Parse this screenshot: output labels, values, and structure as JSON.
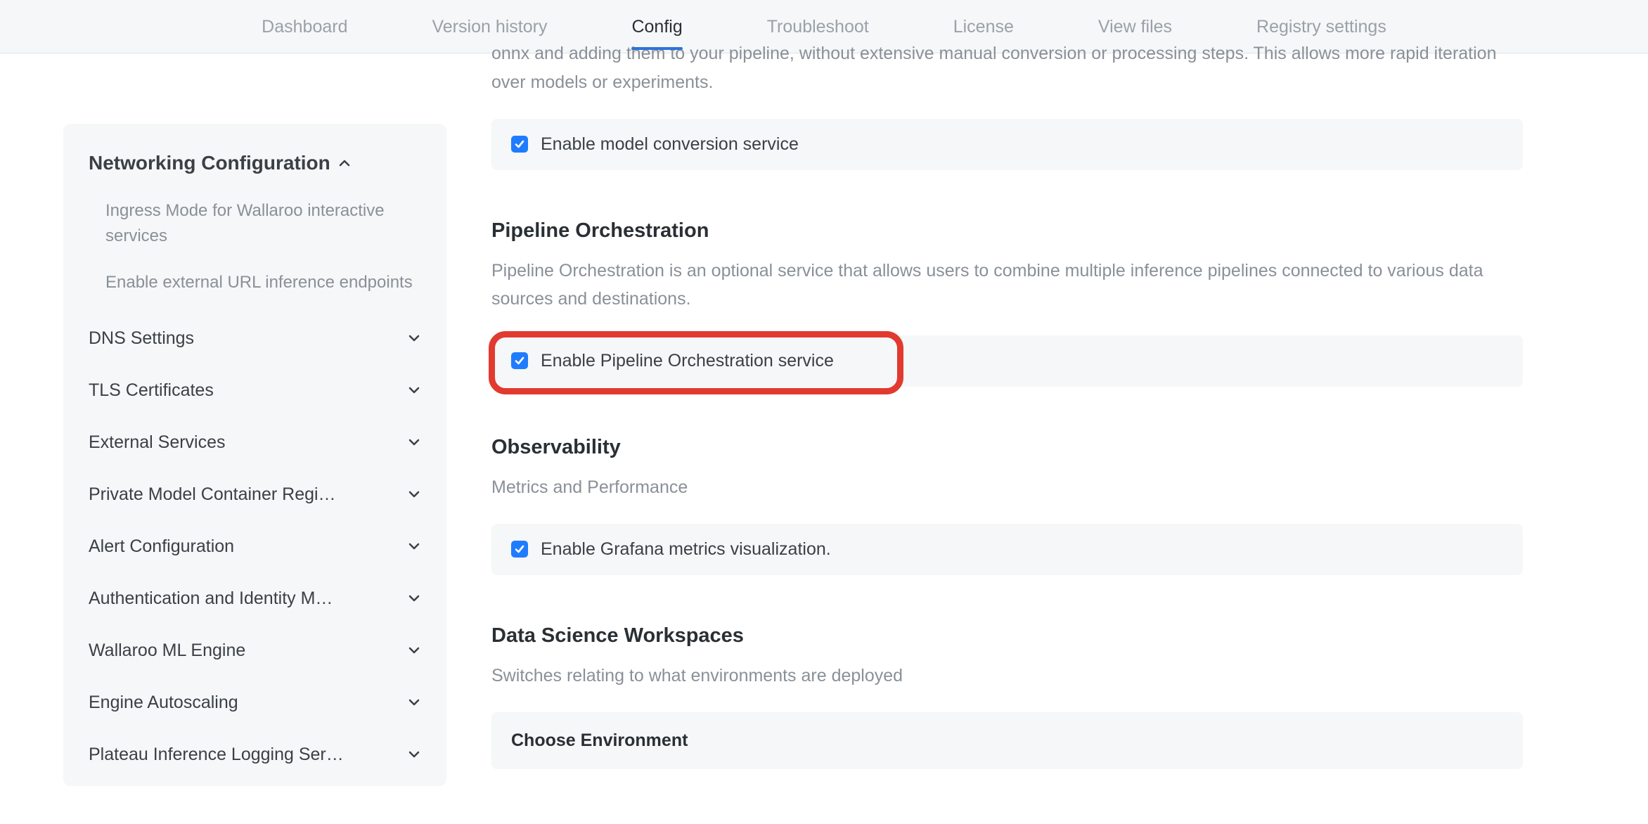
{
  "nav": {
    "items": [
      {
        "label": "Dashboard",
        "active": false
      },
      {
        "label": "Version history",
        "active": false
      },
      {
        "label": "Config",
        "active": true
      },
      {
        "label": "Troubleshoot",
        "active": false
      },
      {
        "label": "License",
        "active": false
      },
      {
        "label": "View files",
        "active": false
      },
      {
        "label": "Registry settings",
        "active": false
      }
    ]
  },
  "sidebar": {
    "expanded_section": "Networking Configuration",
    "subitems": [
      "Ingress Mode for Wallaroo interactive services",
      "Enable external URL inference endpoints"
    ],
    "items": [
      "DNS Settings",
      "TLS Certificates",
      "External Services",
      "Private Model Container Regi…",
      "Alert Configuration",
      "Authentication and Identity M…",
      "Wallaroo ML Engine",
      "Engine Autoscaling",
      "Plateau Inference Logging Ser…"
    ]
  },
  "main": {
    "intro_fragment": "onnx and adding them to your pipeline, without extensive manual conversion or processing steps. This allows more rapid iteration over models or experiments.",
    "model_conversion_label": "Enable model conversion service",
    "pipeline": {
      "heading": "Pipeline Orchestration",
      "desc": "Pipeline Orchestration is an optional service that allows users to combine multiple inference pipelines connected to various data sources and destinations.",
      "checkbox_label": "Enable Pipeline Orchestration service"
    },
    "observability": {
      "heading": "Observability",
      "desc": "Metrics and Performance",
      "checkbox_label": "Enable Grafana metrics visualization."
    },
    "dsw": {
      "heading": "Data Science Workspaces",
      "desc": "Switches relating to what environments are deployed",
      "dropdown_label": "Choose Environment"
    }
  }
}
